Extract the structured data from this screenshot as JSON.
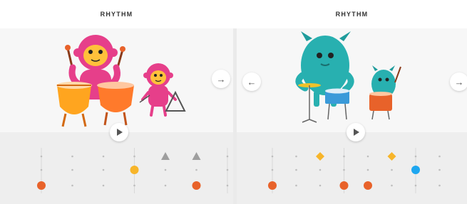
{
  "panels": [
    {
      "title": "RHYTHM",
      "nav": {
        "next_label": "→"
      },
      "colors": {
        "note_orange": "#e8622a",
        "note_yellow": "#f7b52a",
        "note_gray": "#9e9e9e"
      },
      "sequencer": {
        "columns": 8,
        "rows": 3,
        "notes": [
          {
            "col": 0,
            "row": 2,
            "shape": "circle",
            "color": "#e8622a"
          },
          {
            "col": 3,
            "row": 1,
            "shape": "circle",
            "color": "#f7b52a"
          },
          {
            "col": 4,
            "row": 0,
            "shape": "triangle",
            "color": "#9e9e9e"
          },
          {
            "col": 5,
            "row": 0,
            "shape": "triangle",
            "color": "#9e9e9e"
          },
          {
            "col": 5,
            "row": 2,
            "shape": "circle",
            "color": "#e8622a"
          }
        ]
      }
    },
    {
      "title": "RHYTHM",
      "nav": {
        "prev_label": "←",
        "next_label": "→"
      },
      "colors": {
        "note_orange": "#e8622a",
        "note_yellow": "#f7b52a",
        "note_blue": "#1ea7f0"
      },
      "sequencer": {
        "columns": 8,
        "rows": 3,
        "notes": [
          {
            "col": 0,
            "row": 2,
            "shape": "circle",
            "color": "#e8622a"
          },
          {
            "col": 2,
            "row": 0,
            "shape": "diamond",
            "color": "#f7b52a"
          },
          {
            "col": 3,
            "row": 2,
            "shape": "circle",
            "color": "#e8622a"
          },
          {
            "col": 4,
            "row": 2,
            "shape": "circle",
            "color": "#e8622a"
          },
          {
            "col": 5,
            "row": 0,
            "shape": "diamond",
            "color": "#f7b52a"
          },
          {
            "col": 6,
            "row": 1,
            "shape": "circle",
            "color": "#1ea7f0"
          }
        ]
      }
    }
  ]
}
